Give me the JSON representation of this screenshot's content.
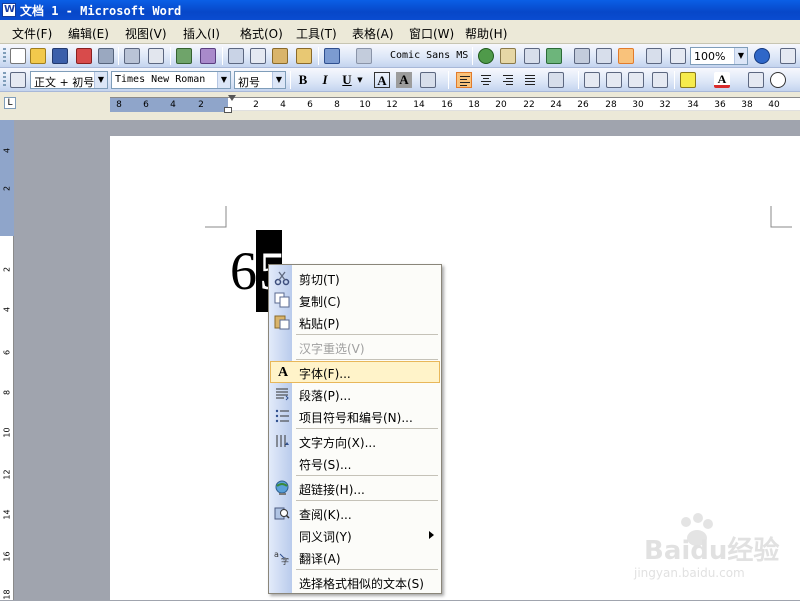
{
  "window": {
    "title": "文档 1 - Microsoft Word"
  },
  "menubar": [
    "文件(F)",
    "编辑(E)",
    "视图(V)",
    "插入(I)",
    "格式(O)",
    "工具(T)",
    "表格(A)",
    "窗口(W)",
    "帮助(H)"
  ],
  "standard_toolbar": {
    "font_preview": "Comic Sans MS",
    "zoom": "100%"
  },
  "formatting_toolbar": {
    "style": "正文 + 初号",
    "font": "Times New Roman",
    "size": "初号",
    "bold": "B",
    "italic": "I",
    "underline": "U",
    "char_border": "A",
    "char_shade": "A"
  },
  "ruler": {
    "ticks": [
      "8",
      "6",
      "4",
      "2",
      "2",
      "4",
      "6",
      "8",
      "10",
      "12",
      "14",
      "16",
      "18",
      "20",
      "22",
      "24",
      "26",
      "28",
      "30",
      "32",
      "34",
      "36",
      "38",
      "40"
    ]
  },
  "vruler": {
    "ticks": [
      "4",
      "2",
      "2",
      "4",
      "6",
      "8",
      "10",
      "12",
      "14",
      "16",
      "18"
    ]
  },
  "document": {
    "text_before": "6",
    "selected_text": "5"
  },
  "context_menu": {
    "items": [
      {
        "label": "剪切(T)",
        "icon": "scissors-icon",
        "disabled": false
      },
      {
        "label": "复制(C)",
        "icon": "copy-icon",
        "disabled": false
      },
      {
        "label": "粘贴(P)",
        "icon": "paste-icon",
        "disabled": false
      },
      {
        "label": "汉字重选(V)",
        "icon": "",
        "disabled": true
      },
      {
        "label": "字体(F)...",
        "icon": "font-icon",
        "disabled": false,
        "highlighted": true
      },
      {
        "label": "段落(P)...",
        "icon": "paragraph-icon",
        "disabled": false
      },
      {
        "label": "项目符号和编号(N)...",
        "icon": "bullets-icon",
        "disabled": false
      },
      {
        "label": "文字方向(X)...",
        "icon": "text-direction-icon",
        "disabled": false
      },
      {
        "label": "符号(S)...",
        "icon": "",
        "disabled": false
      },
      {
        "label": "超链接(H)...",
        "icon": "hyperlink-icon",
        "disabled": false
      },
      {
        "label": "查阅(K)...",
        "icon": "research-icon",
        "disabled": false
      },
      {
        "label": "同义词(Y)",
        "icon": "",
        "disabled": false,
        "submenu": true
      },
      {
        "label": "翻译(A)",
        "icon": "translate-icon",
        "disabled": false
      },
      {
        "label": "选择格式相似的文本(S)",
        "icon": "",
        "disabled": false
      }
    ]
  },
  "watermark": {
    "text": "Baidu经验",
    "sub": "jingyan.baidu.com"
  }
}
